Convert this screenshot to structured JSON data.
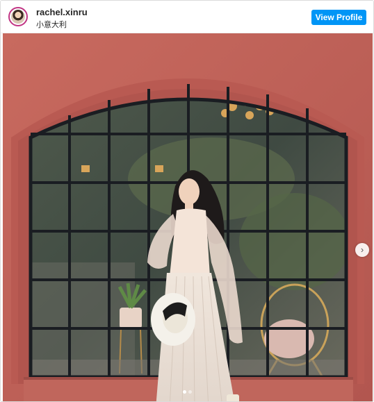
{
  "post": {
    "username": "rachel.xinru",
    "location": "小意大利",
    "view_profile_label": "View Profile"
  },
  "media": {
    "description_icon": "photo-scene",
    "next_icon": "chevron-right-icon",
    "next_glyph": "›",
    "carousel_total": 2,
    "carousel_current": 1
  },
  "colors": {
    "accent": "#0095f6",
    "wall": "#c0625a",
    "frame": "#1a1d22"
  }
}
